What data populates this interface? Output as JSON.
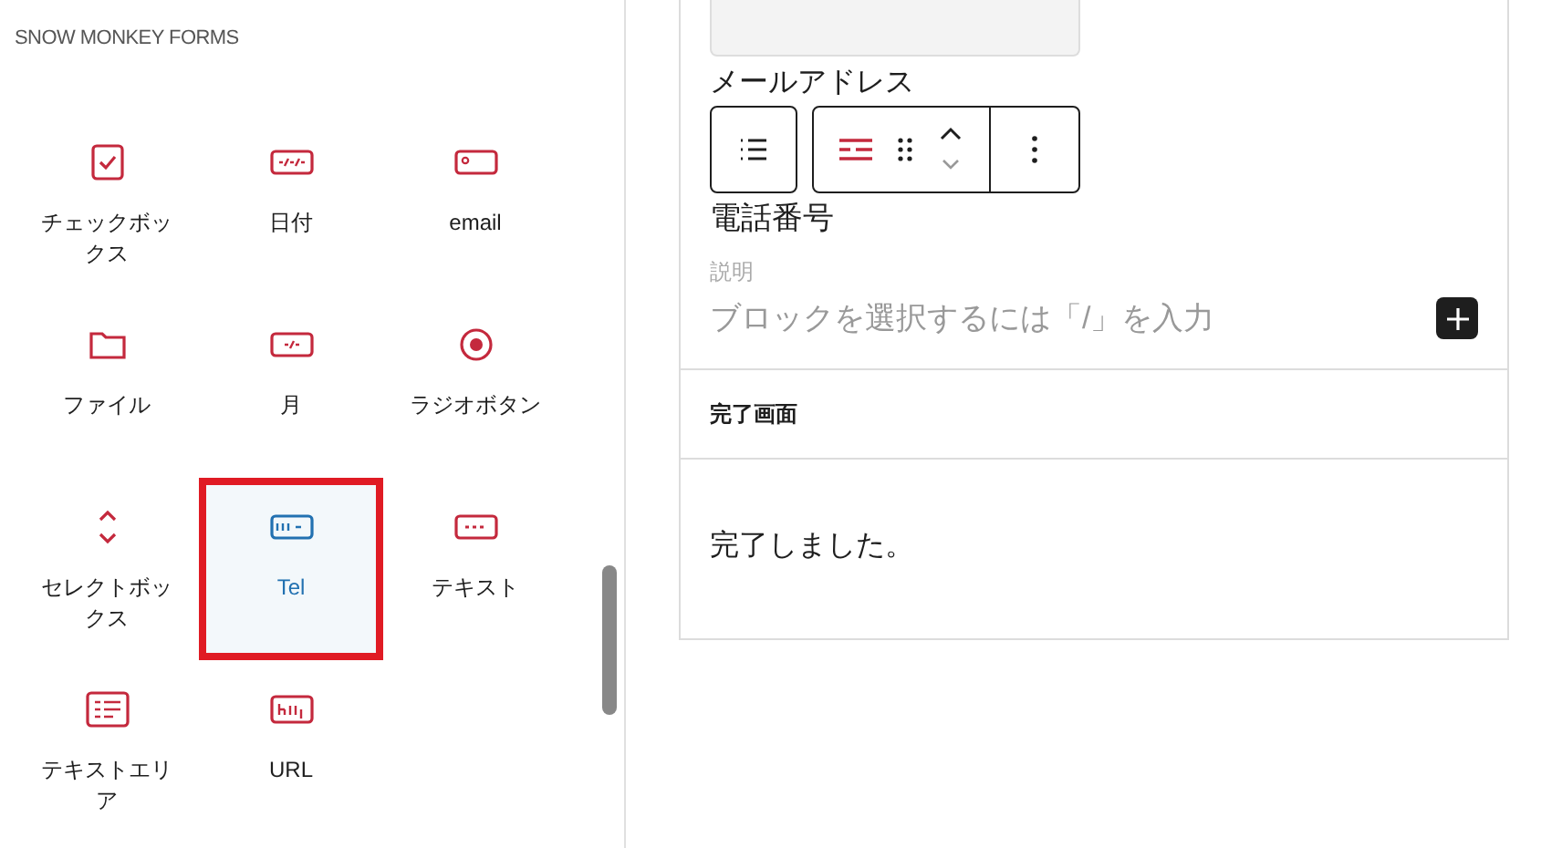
{
  "sidebar": {
    "heading": "SNOW MONKEY FORMS",
    "blocks": [
      {
        "kind": "checkbox",
        "label": "チェックボックス",
        "selected": false
      },
      {
        "kind": "date",
        "label": "日付",
        "selected": false
      },
      {
        "kind": "email",
        "label": "email",
        "selected": false
      },
      {
        "kind": "file",
        "label": "ファイル",
        "selected": false
      },
      {
        "kind": "month",
        "label": "月",
        "selected": false
      },
      {
        "kind": "radio",
        "label": "ラジオボタン",
        "selected": false
      },
      {
        "kind": "select",
        "label": "セレクトボックス",
        "selected": false
      },
      {
        "kind": "tel",
        "label": "Tel",
        "selected": true
      },
      {
        "kind": "text",
        "label": "テキスト",
        "selected": false
      },
      {
        "kind": "textarea",
        "label": "テキストエリア",
        "selected": false
      },
      {
        "kind": "url",
        "label": "URL",
        "selected": false
      }
    ]
  },
  "editor": {
    "email_label": "メールアドレス",
    "tel_label": "電話番号",
    "description_label": "説明",
    "placeholder": "ブロックを選択するには「/」を入力",
    "complete_heading": "完了画面",
    "complete_message": "完了しました。"
  }
}
